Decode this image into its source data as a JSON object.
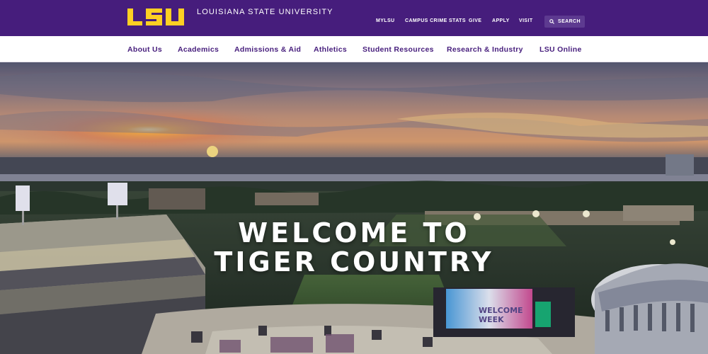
{
  "brand": {
    "logo_text": "LSU",
    "university_name": "LOUISIANA STATE UNIVERSITY",
    "purple": "#461d7c",
    "gold": "#fdd023"
  },
  "utility_nav": [
    {
      "label": "MYLSU"
    },
    {
      "label": "CAMPUS CRIME STATS"
    },
    {
      "label": "GIVE"
    },
    {
      "label": "APPLY"
    },
    {
      "label": "VISIT"
    }
  ],
  "search": {
    "label": "SEARCH",
    "icon": "search-icon"
  },
  "main_nav": [
    {
      "label": "About Us"
    },
    {
      "label": "Academics"
    },
    {
      "label": "Admissions & Aid"
    },
    {
      "label": "Athletics"
    },
    {
      "label": "Student Resources"
    },
    {
      "label": "Research & Industry"
    },
    {
      "label": "LSU Online"
    }
  ],
  "hero": {
    "line1": "WELCOME TO",
    "line2": "TIGER COUNTRY",
    "scoreboard_text_1": "WELCOME",
    "scoreboard_text_2": "WEEK"
  }
}
